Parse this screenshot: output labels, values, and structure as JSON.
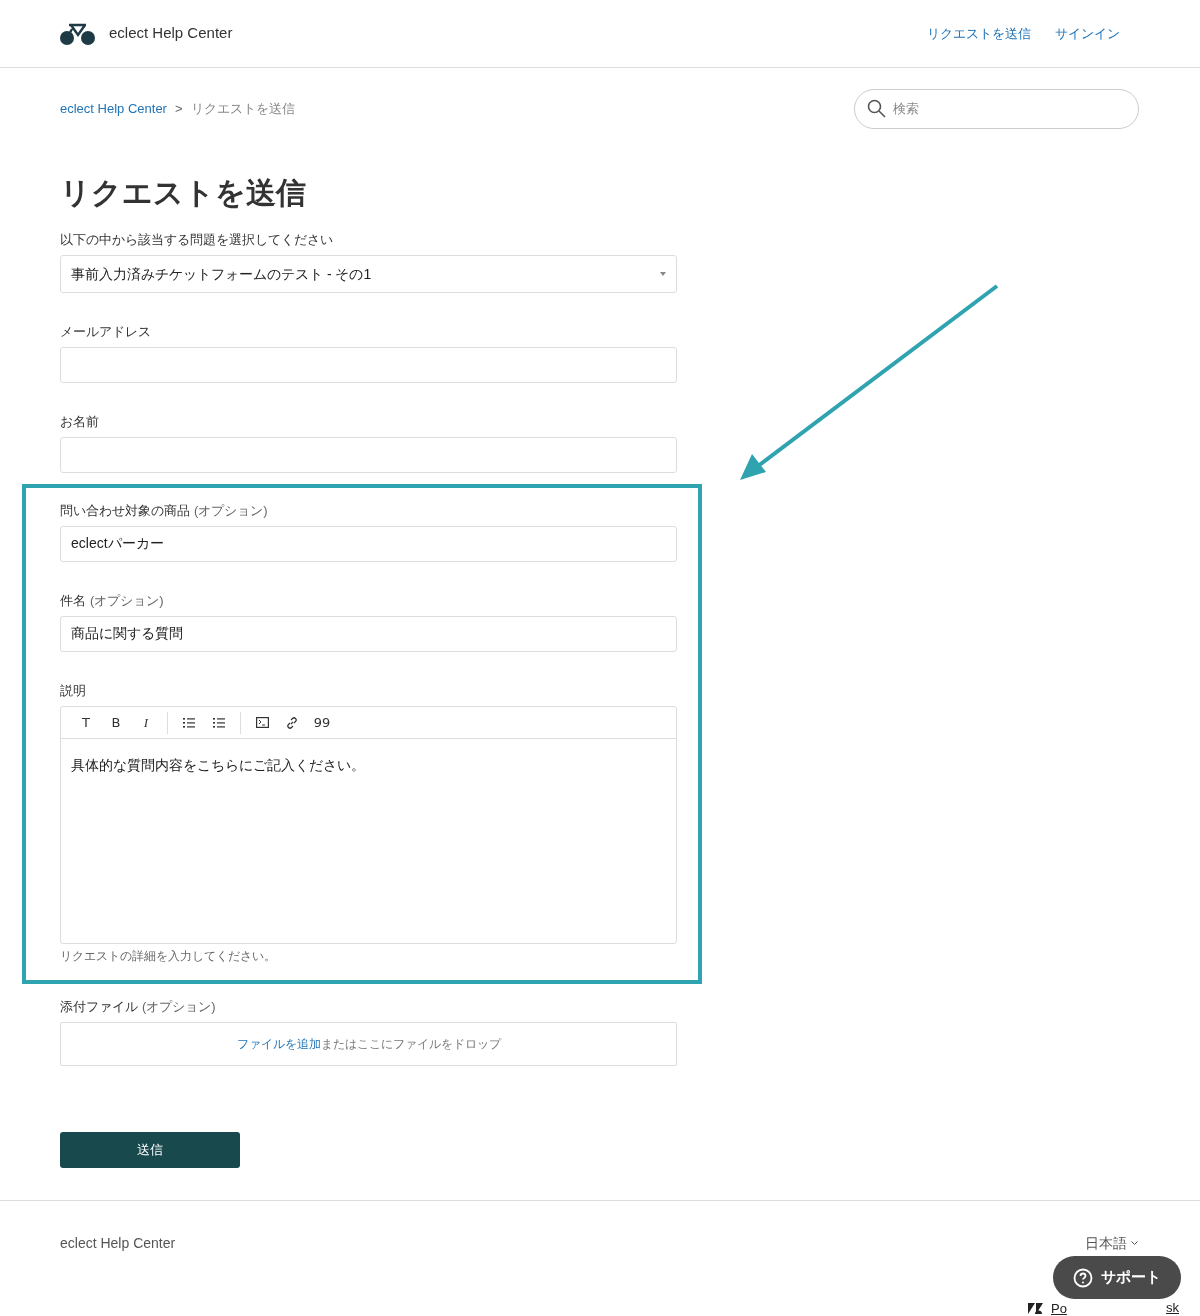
{
  "header": {
    "brand": "eclect Help Center",
    "nav": [
      "リクエストを送信",
      "サインイン"
    ]
  },
  "breadcrumb": {
    "items": [
      "eclect Help Center",
      "リクエストを送信"
    ],
    "separator": ">"
  },
  "search": {
    "placeholder": "検索"
  },
  "title": "リクエストを送信",
  "form": {
    "ticket_form": {
      "label": "以下の中から該当する問題を選択してください",
      "value": "事前入力済みチケットフォームのテスト - その1"
    },
    "fields": [
      {
        "label": "メールアドレス"
      },
      {
        "label": "お名前"
      }
    ],
    "highlighted_section": {
      "fields": [
        {
          "label": "問い合わせ対象の商品",
          "optional": "(オプション)",
          "value": "eclectパーカー"
        },
        {
          "label": "件名",
          "optional": "(オプション)",
          "value": "商品に関する質問"
        }
      ],
      "description": {
        "label": "説明",
        "toolbar": [
          {
            "kind": "text",
            "glyph": "T"
          },
          {
            "kind": "text",
            "glyph": "B"
          },
          {
            "kind": "italic",
            "glyph": "I"
          },
          {
            "kind": "sep"
          },
          {
            "kind": "bullets"
          },
          {
            "kind": "numbers"
          },
          {
            "kind": "sep"
          },
          {
            "kind": "code"
          },
          {
            "kind": "link"
          },
          {
            "kind": "text",
            "glyph": "99"
          }
        ],
        "value": "具体的な質問内容をこちらにご記入ください。",
        "hint": "リクエストの詳細を入力してください。"
      }
    },
    "attachments": {
      "label": "添付ファイル",
      "optional": "(オプション)",
      "link": "ファイルを追加",
      "text": "またはここにファイルをドロップ"
    },
    "submit": "送信"
  },
  "footer": {
    "brand": "eclect Help Center",
    "language": "日本語",
    "powered_by": [
      "Po",
      "sk"
    ]
  },
  "support_button": "サポート"
}
